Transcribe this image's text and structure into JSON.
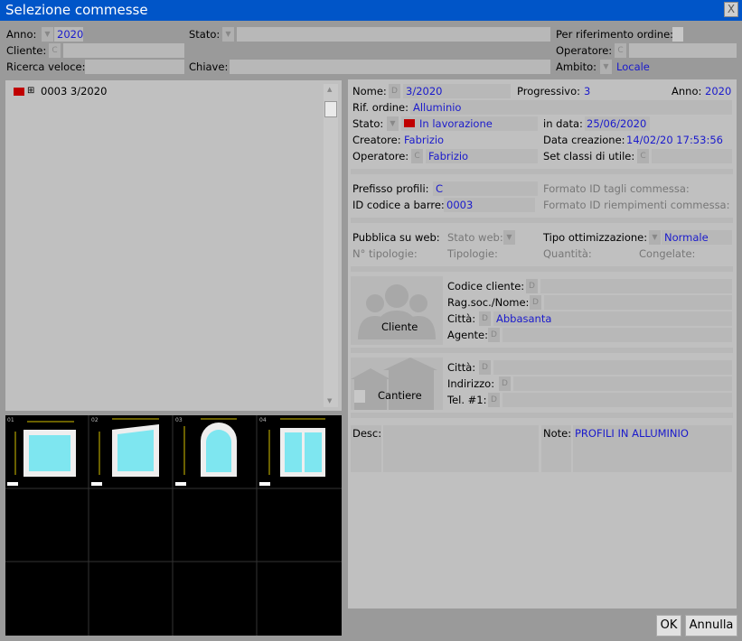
{
  "window": {
    "title": "Selezione commesse",
    "close": "X"
  },
  "filters": {
    "anno_label": "Anno:",
    "anno_value": "2020",
    "stato_label": "Stato:",
    "rif_ordine_label": "Per riferimento ordine:",
    "cliente_label": "Cliente:",
    "cliente_btn": "C",
    "operatore_label": "Operatore:",
    "operatore_btn": "C",
    "ricerca_label": "Ricerca veloce:",
    "chiave_label": "Chiave:",
    "ambito_label": "Ambito:",
    "ambito_value": "Locale"
  },
  "list": {
    "items": [
      {
        "label": "0003 3/2020"
      }
    ]
  },
  "detail": {
    "nome_label": "Nome:",
    "nome_btn": "D",
    "nome_value": "3/2020",
    "progressivo_label": "Progressivo:",
    "progressivo_value": "3",
    "anno_label": "Anno:",
    "anno_value": "2020",
    "rif_label": "Rif. ordine:",
    "rif_value": "Alluminio",
    "stato_label": "Stato:",
    "stato_value": "In lavorazione",
    "indata_label": "in data:",
    "indata_value": "25/06/2020",
    "creatore_label": "Creatore:",
    "creatore_value": "Fabrizio",
    "datacreaz_label": "Data creazione:",
    "datacreaz_value": "14/02/20  17:53:56",
    "operatore_label": "Operatore:",
    "operatore_btn": "C",
    "operatore_value": "Fabrizio",
    "setclassi_label": "Set classi di utile:",
    "setclassi_btn": "C",
    "prefisso_label": "Prefisso profili:",
    "prefisso_value": "C",
    "formato_tagli_label": "Formato ID tagli commessa:",
    "idcodice_label": "ID codice a barre:",
    "idcodice_value": "0003",
    "formato_riemp_label": "Formato ID riempimenti commessa:",
    "pubblica_label": "Pubblica su web:",
    "statoweb_label": "Stato web:",
    "tipoott_label": "Tipo ottimizzazione:",
    "tipoott_value": "Normale",
    "ntipologie_label": "N° tipologie:",
    "tipologie_label": "Tipologie:",
    "quantita_label": "Quantità:",
    "congelate_label": "Congelate:",
    "cliente_btn_label": "Cliente",
    "codcliente_label": "Codice cliente:",
    "ragsoc_label": "Rag.soc./Nome:",
    "citta_label": "Città:",
    "citta_value": "Abbasanta",
    "agente_label": "Agente:",
    "cantiere_btn_label": "Cantiere",
    "citta2_label": "Città:",
    "indirizzo_label": "Indirizzo:",
    "tel_label": "Tel. #1:",
    "desc_label": "Desc:",
    "note_label": "Note:",
    "note_value": "PROFILI IN ALLUMINIO",
    "d": "D",
    "c": "C"
  },
  "thumbs": [
    "01",
    "02",
    "03",
    "04"
  ],
  "buttons": {
    "ok": "OK",
    "cancel": "Annulla"
  }
}
